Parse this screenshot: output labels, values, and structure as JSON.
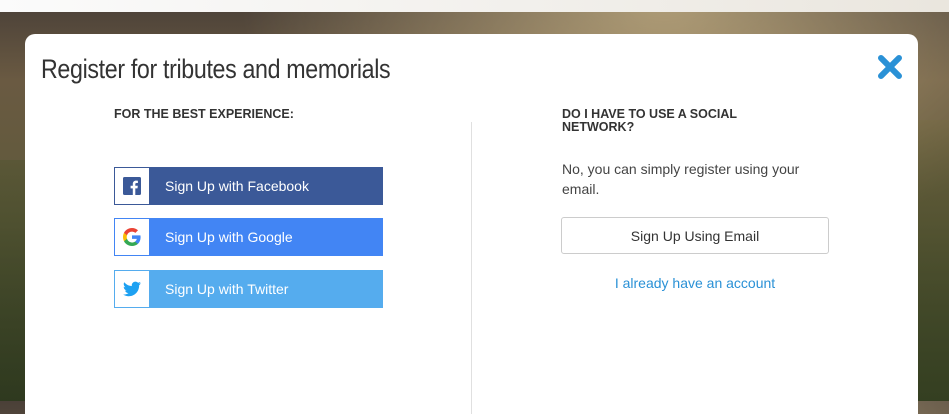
{
  "modal": {
    "title": "Register for tributes and memorials",
    "close_icon": "close-icon"
  },
  "left": {
    "heading": "FOR THE BEST EXPERIENCE:",
    "buttons": [
      {
        "label": "Sign Up with Facebook",
        "icon": "facebook-icon",
        "color": "#3b5998"
      },
      {
        "label": "Sign Up with Google",
        "icon": "google-icon",
        "color": "#4285f4"
      },
      {
        "label": "Sign Up with Twitter",
        "icon": "twitter-icon",
        "color": "#55acee"
      }
    ]
  },
  "right": {
    "heading_line1": "DO I HAVE TO USE A SOCIAL",
    "heading_line2": "NETWORK?",
    "body": "No, you can simply register using your email.",
    "email_button": "Sign Up Using Email",
    "account_link": "I already have an account"
  },
  "colors": {
    "accent": "#2a91d6",
    "close": "#2a91d6"
  }
}
